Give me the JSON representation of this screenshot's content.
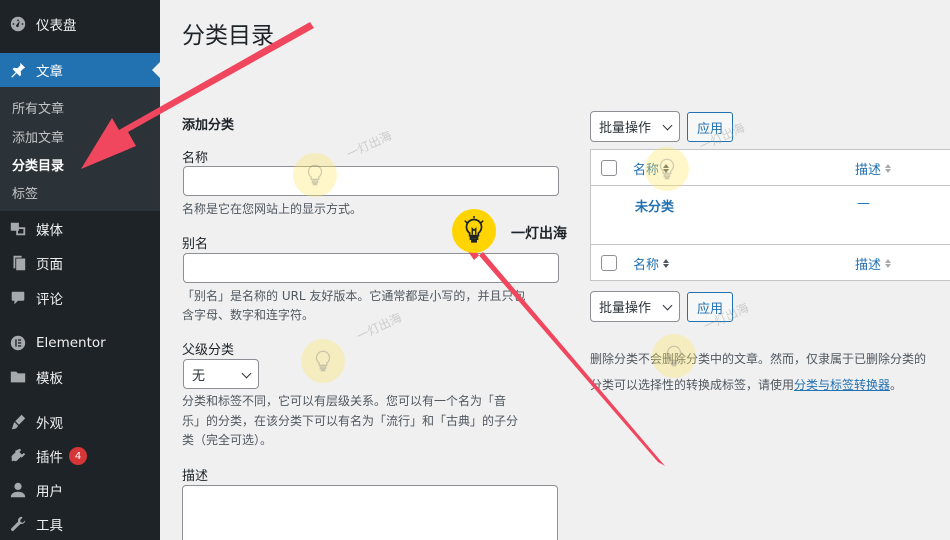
{
  "sidebar": {
    "dashboard": "仪表盘",
    "posts": "文章",
    "submenu": [
      "所有文章",
      "添加文章",
      "分类目录",
      "标签"
    ],
    "media": "媒体",
    "pages": "页面",
    "comments": "评论",
    "elementor": "Elementor",
    "templates": "模板",
    "appearance": "外观",
    "plugins": "插件",
    "plugins_badge": "4",
    "users": "用户",
    "tools": "工具"
  },
  "main": {
    "title": "分类目录",
    "form": {
      "heading": "添加分类",
      "name_label": "名称",
      "name_help": "名称是它在您网站上的显示方式。",
      "slug_label": "别名",
      "slug_help": "「别名」是名称的 URL 友好版本。它通常都是小写的，并且只包含字母、数字和连字符。",
      "slug_help_line1": "「别名」是名称的 URL 友好版本。它通常都是小写的，并且只包",
      "slug_help_line2": "含字母、数字和连字符。",
      "parent_label": "父级分类",
      "parent_value": "无",
      "parent_help_line1": "分类和标签不同，它可以有层级关系。您可以有一个名为「音",
      "parent_help_line2": "乐」的分类，在该分类下可以有名为「流行」和「古典」的子分",
      "parent_help_line3": "类（完全可选）。",
      "desc_label": "描述"
    },
    "list": {
      "bulk_actions": "批量操作",
      "apply": "应用",
      "col_name": "名称",
      "col_desc": "描述",
      "rows": [
        {
          "name": "未分类",
          "desc": "—"
        }
      ],
      "notice_line1": "删除分类不会删除分类中的文章。然而，仅隶属于已删除分类的",
      "notice_line2_prefix": "分类可以选择性的转换成标签，请使用",
      "notice_link": "分类与标签转换器",
      "notice_line2_suffix": "。"
    }
  },
  "watermark": {
    "text": "一灯出海"
  },
  "colors": {
    "sidebar_bg": "#1d2327",
    "submenu_bg": "#2c3338",
    "accent": "#2271b1",
    "badge": "#d63638",
    "arrow": "#f0475f",
    "logo": "#ffd400"
  },
  "icons": [
    "dashboard-icon",
    "pin-icon",
    "media-icon",
    "page-icon",
    "comment-icon",
    "elementor-icon",
    "folder-icon",
    "brush-icon",
    "plugin-icon",
    "user-icon",
    "wrench-icon",
    "bulb-icon"
  ]
}
